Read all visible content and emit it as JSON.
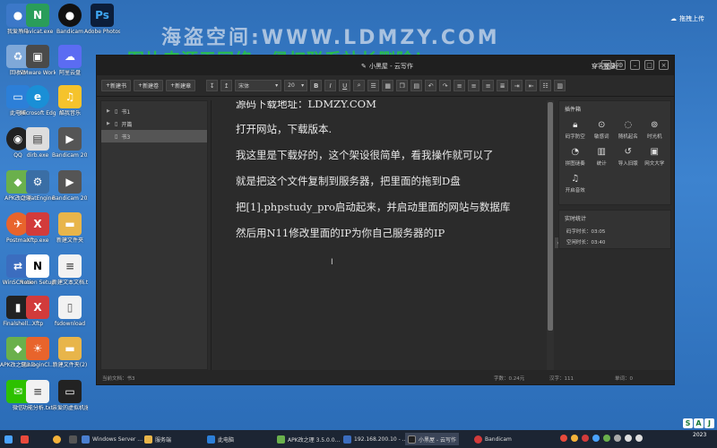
{
  "watermark": {
    "line1": "海盗空间:WWW.LDMZY.COM",
    "line2": "图片来源于网络，侵权联系站长删除！"
  },
  "desktop_icons": [
    {
      "id": "icon-1",
      "caption": "我爱黑马"
    },
    {
      "id": "icon-2",
      "caption": "navicat.exe"
    },
    {
      "id": "icon-3",
      "caption": "Bandicam"
    },
    {
      "id": "icon-4",
      "caption": "Adobe Photosh..."
    },
    {
      "id": "icon-5",
      "caption": "回收站"
    },
    {
      "id": "icon-6",
      "caption": "VMware Workstati..."
    },
    {
      "id": "icon-7",
      "caption": "阿里云盘"
    },
    {
      "id": "icon-8",
      "caption": "此电脑"
    },
    {
      "id": "icon-9",
      "caption": "Microsoft Edge"
    },
    {
      "id": "icon-10",
      "caption": "酷我音乐"
    },
    {
      "id": "icon-11",
      "caption": "QQ"
    },
    {
      "id": "icon-12",
      "caption": "dirb.exe"
    },
    {
      "id": "icon-13",
      "caption": "Bandicam 2023-07-0..."
    },
    {
      "id": "icon-14",
      "caption": "APK改之理"
    },
    {
      "id": "icon-15",
      "caption": "CheatEngine"
    },
    {
      "id": "icon-16",
      "caption": "Bandicam 2023-07-0..."
    },
    {
      "id": "icon-17",
      "caption": "Postman"
    },
    {
      "id": "icon-18",
      "caption": "Xftp.exe"
    },
    {
      "id": "icon-19",
      "caption": "新建文件夹"
    },
    {
      "id": "icon-20",
      "caption": "WinSCP.exe"
    },
    {
      "id": "icon-21",
      "caption": "Notion Setup 2..."
    },
    {
      "id": "icon-22",
      "caption": "新建文本文档.txt"
    },
    {
      "id": "icon-23",
      "caption": "Finalshell..."
    },
    {
      "id": "icon-24",
      "caption": "Xftp"
    },
    {
      "id": "icon-25",
      "caption": "fsdownload"
    },
    {
      "id": "icon-26",
      "caption": "APK改之理3.3.3"
    },
    {
      "id": "icon-27",
      "caption": "SunloginCl..."
    },
    {
      "id": "icon-28",
      "caption": "新建文件夹(2)"
    },
    {
      "id": "icon-29",
      "caption": "微信"
    },
    {
      "id": "icon-30",
      "caption": "功能分析.txt"
    },
    {
      "id": "icon-31",
      "caption": "亲爱的虚拟机服务DNS服务..."
    }
  ],
  "cloud_upload": {
    "label": "拖拽上传"
  },
  "app": {
    "title": "小黑屋 - 云写作",
    "user": "穿客:您好",
    "login": "登录",
    "toolbar": {
      "new_book": "新建书",
      "new_volume": "新建卷",
      "new_chapter": "新建章",
      "font": "宋体",
      "font_size": "20",
      "bold": "B",
      "italic": "I",
      "underline": "U"
    },
    "tree": [
      {
        "label": "书1",
        "expanded": false
      },
      {
        "label": "开篇",
        "expanded": false
      },
      {
        "label": "书3",
        "selected": true
      }
    ],
    "editor_lines": [
      "源码下载地址：LDMZY.COM",
      "打开网站，下载版本.",
      "我这里是下载好的，这个架设很简单，看我操作就可以了",
      "就是把这个文件复制到服务器，把里面的拖到D盘",
      "把[1].phpstudy_pro启动起来，并启动里面的网站与数据库",
      "然后用N11修改里面的IP为你自己服务器的IP"
    ],
    "plugin_panel": {
      "title": "插件箱",
      "plugins": [
        {
          "label": "码字防空",
          "icon": "lock-icon"
        },
        {
          "label": "敏感词",
          "icon": "search-icon"
        },
        {
          "label": "随机起名",
          "icon": "chat-icon"
        },
        {
          "label": "时光机",
          "icon": "ufo-icon"
        },
        {
          "label": "拼图谜奏",
          "icon": "clock-icon"
        },
        {
          "label": "统计",
          "icon": "chart-icon"
        },
        {
          "label": "导入旧版",
          "icon": "history-icon"
        },
        {
          "label": "网文大学",
          "icon": "book-icon"
        },
        {
          "label": "开启音效",
          "icon": "music-icon"
        }
      ]
    },
    "stats_panel": {
      "title": "实时统计",
      "typing_time": "码字时长：03:05",
      "idle_time": "空闲时长：03:40"
    },
    "status": {
      "current_doc": "当前文档：书3",
      "zoom": "字数：0.24元",
      "char_count": "汉字：111",
      "words": "单词：0"
    }
  },
  "taskbar": {
    "items": [
      {
        "label": "Windows Server ..."
      },
      {
        "label": "服务端"
      },
      {
        "label": "此电脑"
      },
      {
        "label": "APK改之理 3.5.0.0..."
      },
      {
        "label": "192.168.200.10 - ..."
      },
      {
        "label": "小黑屋 - 云写作",
        "active": true
      },
      {
        "label": "Bandicam"
      }
    ],
    "clock_line": "2023"
  },
  "saj_logo": [
    "S",
    "A",
    "J"
  ]
}
